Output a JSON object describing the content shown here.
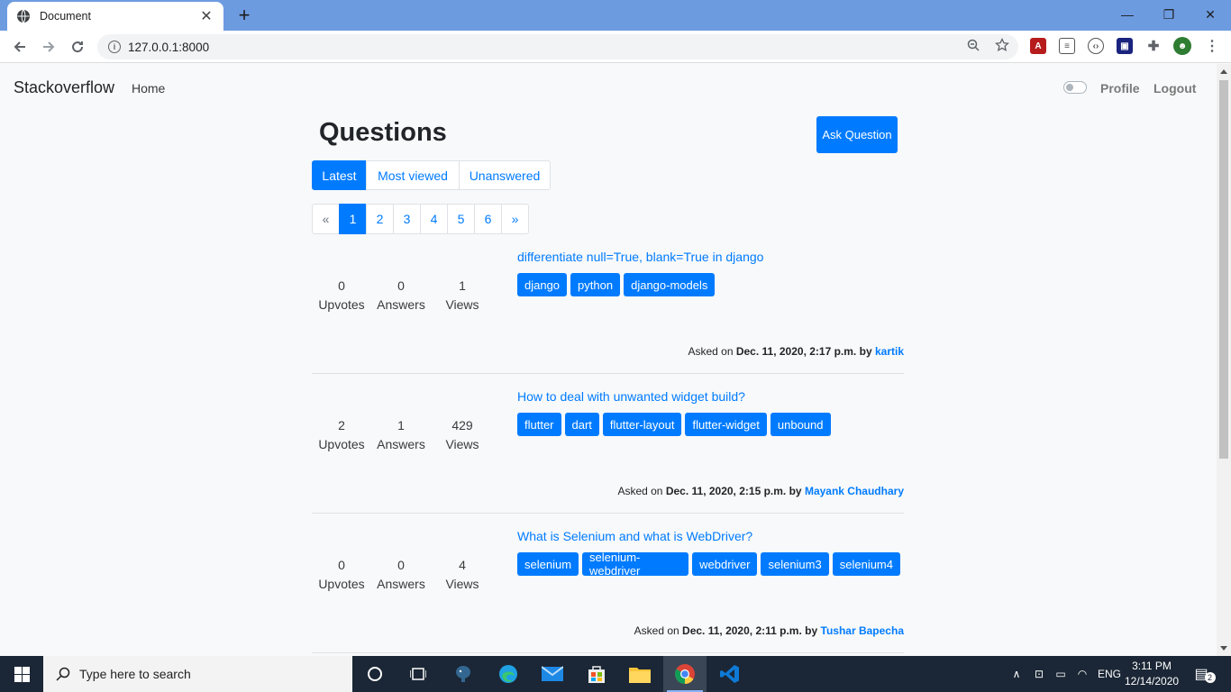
{
  "browser": {
    "tab_title": "Document",
    "url": "127.0.0.1:8000"
  },
  "navbar": {
    "brand": "Stackoverflow",
    "home": "Home",
    "profile": "Profile",
    "logout": "Logout"
  },
  "main": {
    "title": "Questions",
    "ask_button": "Ask Question",
    "filters": [
      "Latest",
      "Most viewed",
      "Unanswered"
    ],
    "active_filter": "Latest",
    "pagination": [
      "«",
      "1",
      "2",
      "3",
      "4",
      "5",
      "6",
      "»"
    ],
    "current_page": "1",
    "stat_labels": {
      "upvotes": "Upvotes",
      "answers": "Answers",
      "views": "Views"
    },
    "asked_prefix": "Asked on",
    "by_word": "by",
    "questions": [
      {
        "title": "differentiate null=True, blank=True in django",
        "upvotes": "0",
        "answers": "0",
        "views": "1",
        "tags": [
          "django",
          "python",
          "django-models"
        ],
        "date": "Dec. 11, 2020, 2:17 p.m.",
        "author": "kartik"
      },
      {
        "title": "How to deal with unwanted widget build?",
        "upvotes": "2",
        "answers": "1",
        "views": "429",
        "tags": [
          "flutter",
          "dart",
          "flutter-layout",
          "flutter-widget",
          "unbound"
        ],
        "date": "Dec. 11, 2020, 2:15 p.m.",
        "author": "Mayank Chaudhary"
      },
      {
        "title": "What is Selenium and what is WebDriver?",
        "upvotes": "0",
        "answers": "0",
        "views": "4",
        "tags": [
          "selenium",
          "selenium-webdriver",
          "webdriver",
          "selenium3",
          "selenium4"
        ],
        "date": "Dec. 11, 2020, 2:11 p.m.",
        "author": "Tushar Bapecha"
      }
    ]
  },
  "taskbar": {
    "search_placeholder": "Type here to search",
    "language": "ENG",
    "time": "3:11 PM",
    "date": "12/14/2020",
    "notification_count": "2"
  }
}
